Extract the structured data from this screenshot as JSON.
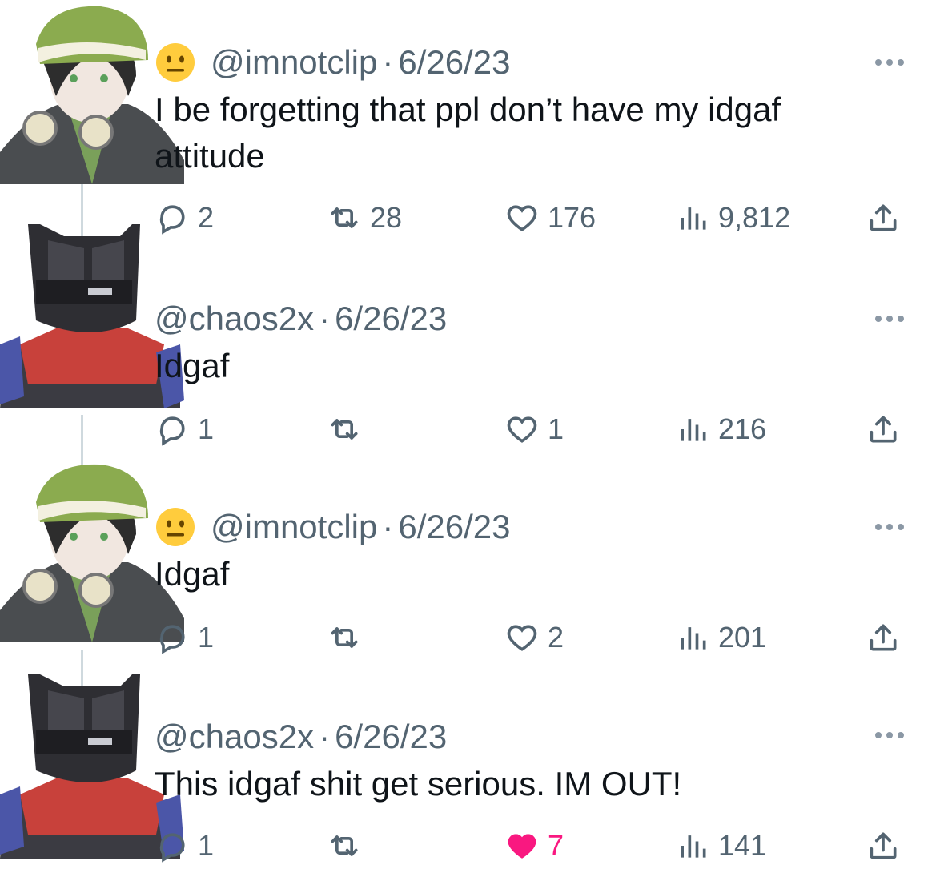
{
  "tweets": [
    {
      "handle": "@imnotclip",
      "sep": "·",
      "date": "6/26/23",
      "has_emoji": true,
      "emoji": "neutral-face",
      "avatar": "green-beanie-anime-avatar",
      "text": "I be forgetting that ppl don’t have my idgaf attitude",
      "replies": "2",
      "retweets": "28",
      "likes": "176",
      "views": "9,812",
      "liked": false
    },
    {
      "handle": "@chaos2x",
      "sep": "·",
      "date": "6/26/23",
      "has_emoji": false,
      "avatar": "black-helmet-avatar",
      "text": "Idgaf",
      "replies": "1",
      "retweets": "",
      "likes": "1",
      "views": "216",
      "liked": false
    },
    {
      "handle": "@imnotclip",
      "sep": "·",
      "date": "6/26/23",
      "has_emoji": true,
      "emoji": "neutral-face",
      "avatar": "green-beanie-anime-avatar",
      "text": "Idgaf",
      "replies": "1",
      "retweets": "",
      "likes": "2",
      "views": "201",
      "liked": false
    },
    {
      "handle": "@chaos2x",
      "sep": "·",
      "date": "6/26/23",
      "has_emoji": false,
      "avatar": "black-helmet-avatar",
      "text": "This idgaf shit get serious. IM OUT!",
      "replies": "1",
      "retweets": "",
      "likes": "7",
      "views": "141",
      "liked": true
    }
  ],
  "colors": {
    "text": "#0f1419",
    "muted": "#536471",
    "like_active": "#f91880",
    "thread_line": "#cfd9de"
  }
}
